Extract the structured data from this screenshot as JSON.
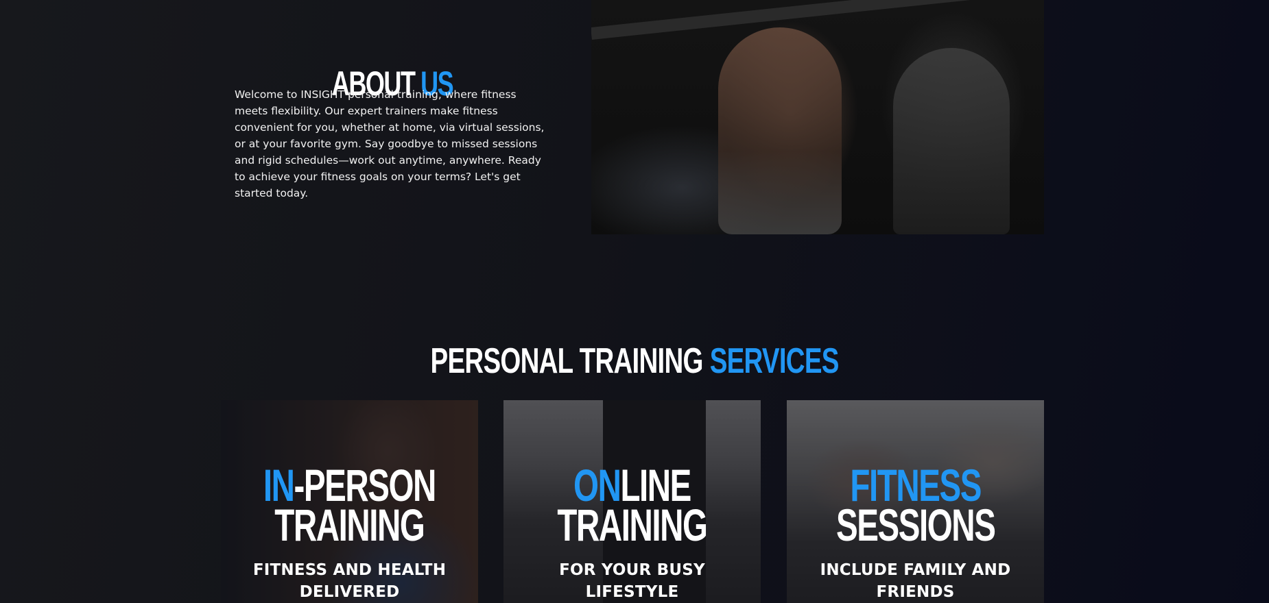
{
  "about": {
    "title_main": "ABOUT ",
    "title_accent": "US",
    "text": "Welcome to INSIGHT personal training, where fitness meets flexibility. Our expert trainers make fitness convenient for you, whether at home, via virtual sessions, or at your favorite gym. Say goodbye to missed sessions and rigid schedules—work out anytime, anywhere. Ready to achieve your fitness goals on your terms? Let's get started today."
  },
  "services": {
    "title_main": "PERSONAL TRAINING ",
    "title_accent": "SERVICES",
    "cards": [
      {
        "accent": "IN",
        "rest": "-PERSON",
        "line2": "TRAINING",
        "subtitle": "FITNESS AND HEALTH DELIVERED"
      },
      {
        "accent": "ON",
        "rest": "LINE",
        "line2": "TRAINING",
        "subtitle": "FOR YOUR BUSY LIFESTYLE"
      },
      {
        "accent": "FITNESS",
        "rest": "",
        "line2": "SESSIONS",
        "subtitle": "INCLUDE FAMILY AND FRIENDS"
      }
    ]
  },
  "colors": {
    "accent": "#2196f3",
    "background": "#121319"
  }
}
